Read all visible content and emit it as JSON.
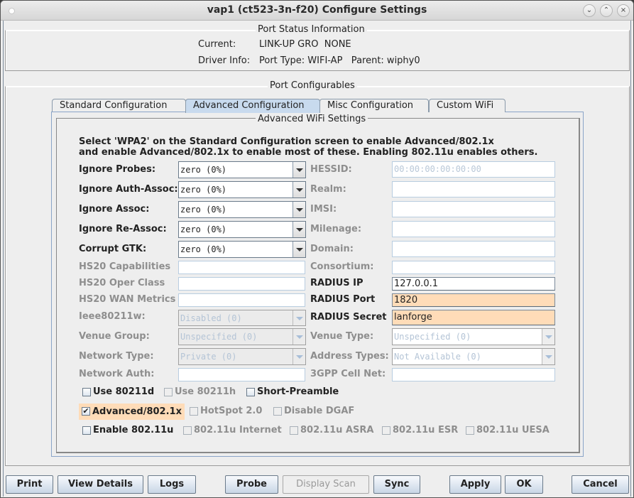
{
  "window": {
    "title": "vap1  (ct523-3n-f20) Configure Settings",
    "controls": [
      "minimize",
      "maximize",
      "close"
    ]
  },
  "status": {
    "title": "Port Status Information",
    "current_label": "Current:",
    "current_value": "LINK-UP GRO  NONE",
    "driver_label": "Driver Info:",
    "driver_value": "Port Type: WIFI-AP   Parent: wiphy0"
  },
  "configurables": {
    "title": "Port Configurables",
    "tabs": [
      {
        "label": "Standard Configuration",
        "active": false
      },
      {
        "label": "Advanced Configuration",
        "active": true
      },
      {
        "label": "Misc Configuration",
        "active": false
      },
      {
        "label": "Custom WiFi",
        "active": false
      }
    ]
  },
  "advanced": {
    "title": "Advanced WiFi Settings",
    "note_line1": "Select 'WPA2' on the Standard Configuration screen to enable Advanced/802.1x",
    "note_line2": "and enable Advanced/802.1x to enable most of these. Enabling 802.11u enables others.",
    "left": [
      {
        "label": "Ignore Probes:",
        "type": "combo",
        "value": "zero (0%)",
        "enabled": true
      },
      {
        "label": "Ignore Auth-Assoc:",
        "type": "combo",
        "value": "zero (0%)",
        "enabled": true
      },
      {
        "label": "Ignore Assoc:",
        "type": "combo",
        "value": "zero (0%)",
        "enabled": true
      },
      {
        "label": "Ignore Re-Assoc:",
        "type": "combo",
        "value": "zero (0%)",
        "enabled": true
      },
      {
        "label": "Corrupt GTK:",
        "type": "combo",
        "value": "zero (0%)",
        "enabled": true
      },
      {
        "label": "HS20 Capabilities",
        "type": "text",
        "value": "",
        "enabled": false
      },
      {
        "label": "HS20 Oper Class",
        "type": "text",
        "value": "",
        "enabled": false
      },
      {
        "label": "HS20 WAN Metrics",
        "type": "text",
        "value": "",
        "enabled": false
      },
      {
        "label": "Ieee80211w:",
        "type": "combo",
        "value": "Disabled (0)",
        "enabled": false
      },
      {
        "label": "Venue Group:",
        "type": "combo",
        "value": "Unspecified (0)",
        "enabled": false
      },
      {
        "label": "Network Type:",
        "type": "combo",
        "value": "Private (0)",
        "enabled": false
      },
      {
        "label": "Network Auth:",
        "type": "text",
        "value": "",
        "enabled": false
      }
    ],
    "right": [
      {
        "label": "HESSID:",
        "type": "text",
        "value": "",
        "placeholder": "00:00:00:00:00:00",
        "enabled": false
      },
      {
        "label": "Realm:",
        "type": "text",
        "value": "",
        "enabled": false
      },
      {
        "label": "IMSI:",
        "type": "text",
        "value": "",
        "enabled": false
      },
      {
        "label": "Milenage:",
        "type": "text",
        "value": "",
        "enabled": false
      },
      {
        "label": "Domain:",
        "type": "text",
        "value": "",
        "enabled": false
      },
      {
        "label": "Consortium:",
        "type": "text",
        "value": "",
        "enabled": false
      },
      {
        "label": "RADIUS IP",
        "type": "text",
        "value": "127.0.0.1",
        "enabled": true
      },
      {
        "label": "RADIUS Port",
        "type": "text",
        "value": "1820",
        "enabled": true,
        "highlight": true
      },
      {
        "label": "RADIUS Secret",
        "type": "text",
        "value": "lanforge",
        "enabled": true,
        "highlight": true
      },
      {
        "label": "Venue Type:",
        "type": "combo",
        "value": "Unspecified (0)",
        "enabled": false
      },
      {
        "label": "Address Types:",
        "type": "combo",
        "value": "Not Available (0)",
        "enabled": false
      },
      {
        "label": "3GPP Cell Net:",
        "type": "text",
        "value": "",
        "enabled": false
      }
    ],
    "checkboxes": [
      {
        "label": "Use 80211d",
        "checked": false,
        "enabled": true
      },
      {
        "label": "Use 80211h",
        "checked": false,
        "enabled": false
      },
      {
        "label": "Short-Preamble",
        "checked": false,
        "enabled": true
      },
      {
        "label": "Advanced/802.1x",
        "checked": true,
        "enabled": true,
        "highlight": true
      },
      {
        "label": "HotSpot 2.0",
        "checked": false,
        "enabled": false
      },
      {
        "label": "Disable DGAF",
        "checked": false,
        "enabled": false
      },
      {
        "label": "Enable 802.11u",
        "checked": false,
        "enabled": true
      },
      {
        "label": "802.11u Internet",
        "checked": false,
        "enabled": false
      },
      {
        "label": "802.11u ASRA",
        "checked": false,
        "enabled": false
      },
      {
        "label": "802.11u ESR",
        "checked": false,
        "enabled": false
      },
      {
        "label": "802.11u UESA",
        "checked": false,
        "enabled": false
      }
    ],
    "highlight_color": "#ffdcb8"
  },
  "buttons": [
    {
      "label": "Print",
      "enabled": true
    },
    {
      "label": "View Details",
      "enabled": true
    },
    {
      "label": "Logs",
      "enabled": true
    },
    {
      "label": "Probe",
      "enabled": true
    },
    {
      "label": "Display Scan",
      "enabled": false
    },
    {
      "label": "Sync",
      "enabled": true
    },
    {
      "label": "Apply",
      "enabled": true
    },
    {
      "label": "OK",
      "enabled": true
    },
    {
      "label": "Cancel",
      "enabled": true
    }
  ]
}
